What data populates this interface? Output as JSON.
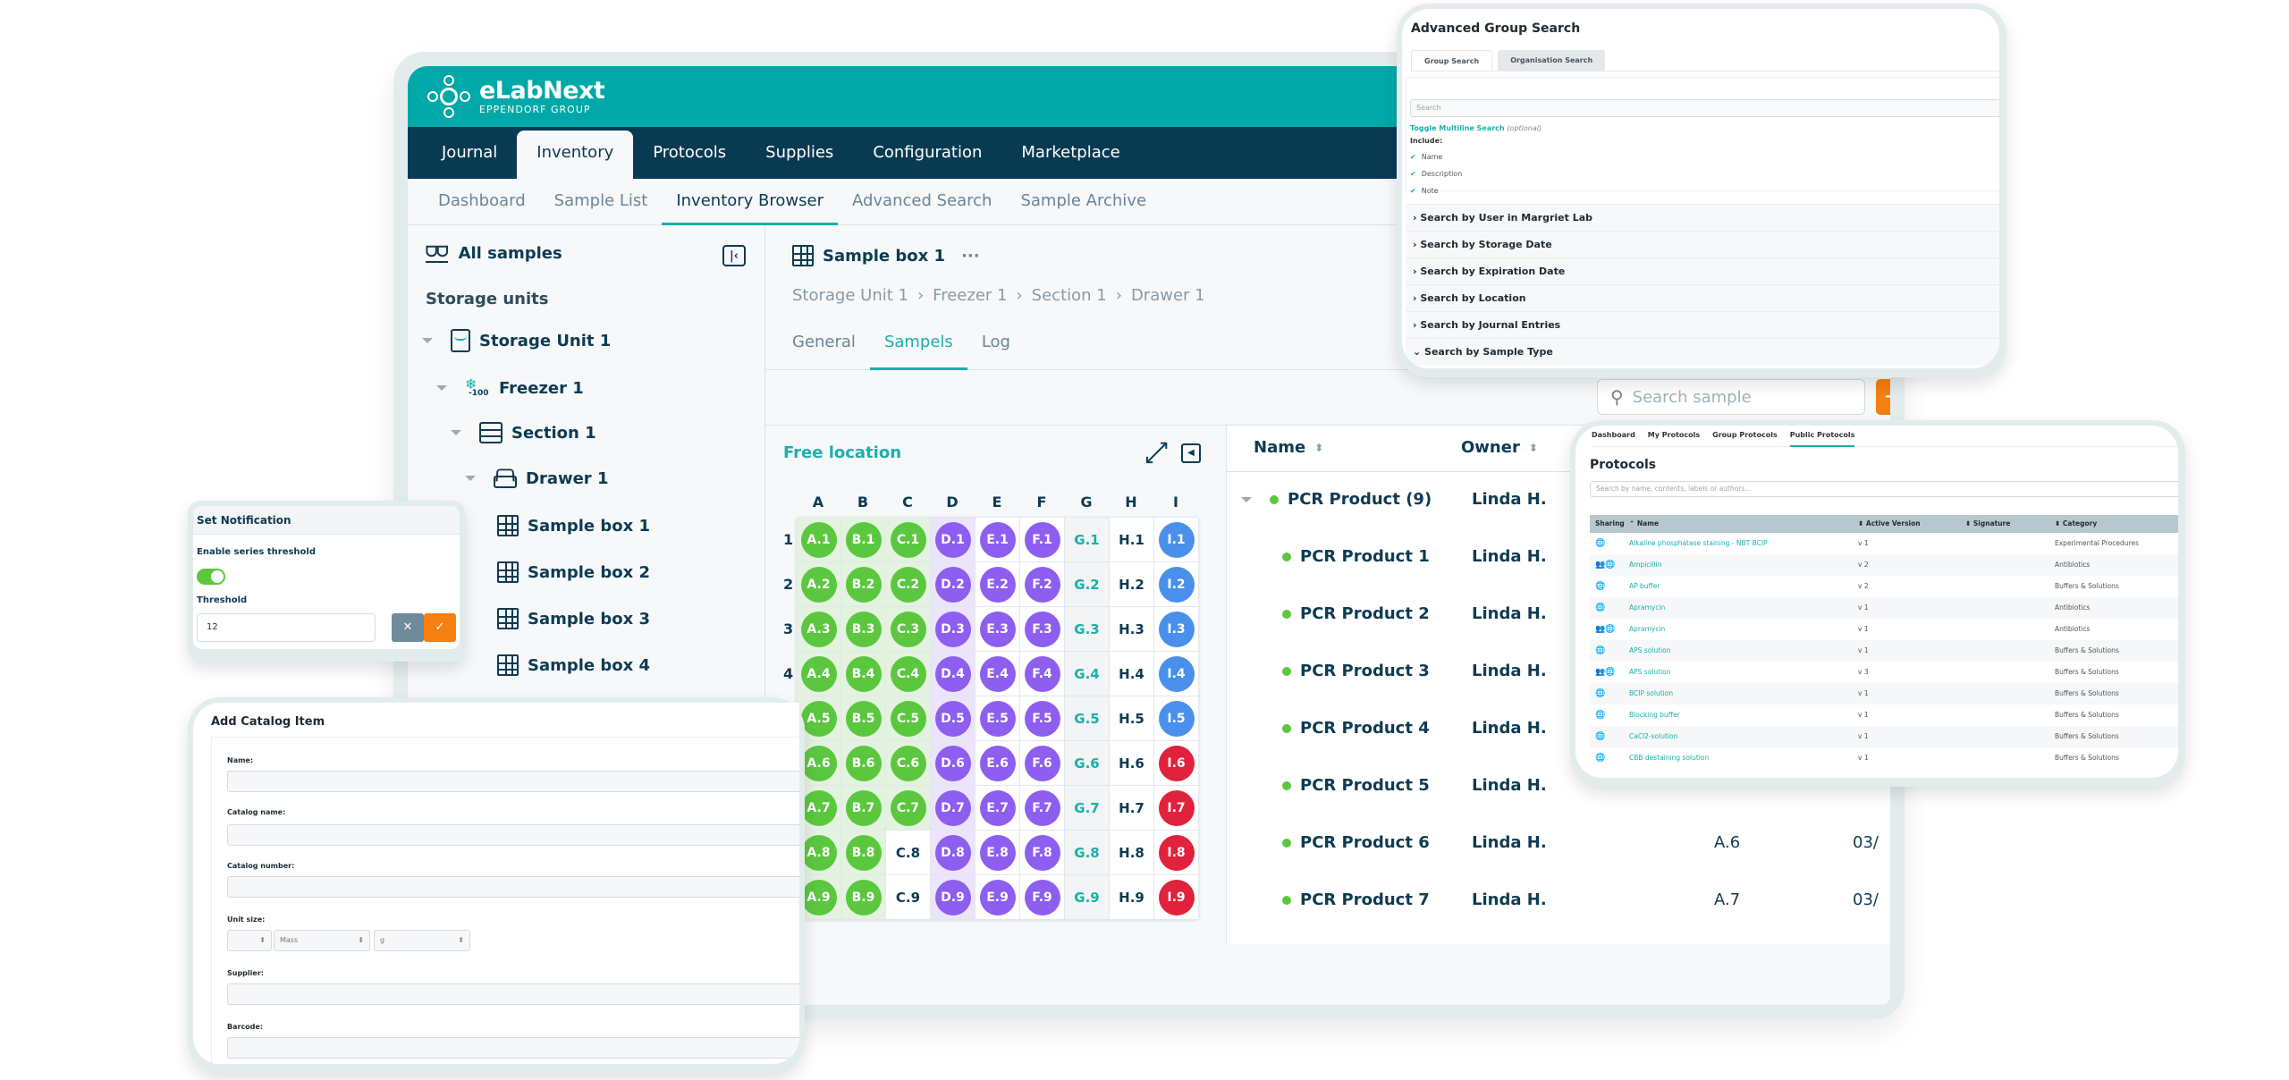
{
  "brand": {
    "name": "eLabNext",
    "sub": "EPPENDORF GROUP",
    "accent": "#00a8a8",
    "nav_bg": "#083a52",
    "action": "#f57f11"
  },
  "main_nav": [
    "Journal",
    "Inventory",
    "Protocols",
    "Supplies",
    "Configuration",
    "Marketplace"
  ],
  "main_nav_active": "Inventory",
  "sub_nav": [
    "Dashboard",
    "Sample List",
    "Inventory Browser",
    "Advanced Search",
    "Sample Archive"
  ],
  "sub_nav_active": "Inventory Browser",
  "sidebar": {
    "all_samples": "All samples",
    "storage_units_label": "Storage units",
    "tree": [
      {
        "label": "Storage Unit 1",
        "icon": "storage-unit-icon",
        "level": 0,
        "expanded": true
      },
      {
        "label": "Freezer 1",
        "icon": "freezer-icon",
        "icon_text": "-100",
        "level": 1,
        "expanded": true
      },
      {
        "label": "Section 1",
        "icon": "section-icon",
        "level": 2,
        "expanded": true
      },
      {
        "label": "Drawer 1",
        "icon": "drawer-icon",
        "level": 3,
        "expanded": true
      },
      {
        "label": "Sample box 1",
        "icon": "sample-box-icon",
        "level": 4
      },
      {
        "label": "Sample box 2",
        "icon": "sample-box-icon",
        "level": 4
      },
      {
        "label": "Sample box 3",
        "icon": "sample-box-icon",
        "level": 4
      },
      {
        "label": "Sample box 4",
        "icon": "sample-box-icon",
        "level": 4
      }
    ]
  },
  "content": {
    "title": "Sample box 1",
    "more": "···",
    "breadcrumb": [
      "Storage Unit 1",
      "Freezer 1",
      "Section 1",
      "Drawer 1"
    ],
    "breadcrumb_sep": "›",
    "tabs": [
      "General",
      "Sampels",
      "Log"
    ],
    "active_tab": "Sampels",
    "search_placeholder": "Search sample",
    "add_label": "+"
  },
  "plate": {
    "title": "Free location",
    "columns": [
      "A",
      "B",
      "C",
      "D",
      "E",
      "F",
      "G",
      "H",
      "I"
    ],
    "rows": [
      "1",
      "2",
      "3",
      "4",
      "5",
      "6",
      "7",
      "8",
      "9"
    ],
    "colors": {
      "green": "#5bc73f",
      "purple": "#8d5ef0",
      "blue": "#4a90ea",
      "red": "#e0223d"
    },
    "column_status": {
      "A": "green",
      "B": "green",
      "C": "green",
      "D": "purple",
      "E": "purple",
      "F": "purple",
      "G": "free",
      "H": "empty",
      "I": "blue"
    },
    "overrides": {
      "C.8": "empty",
      "C.9": "empty",
      "I.6": "red",
      "I.7": "red",
      "I.8": "red",
      "I.9": "red"
    }
  },
  "sample_list": {
    "columns": [
      "Name",
      "Owner"
    ],
    "group": {
      "name": "PCR Product (9)",
      "owner": "Linda H."
    },
    "rows": [
      {
        "name": "PCR Product 1",
        "owner": "Linda H.",
        "position": "",
        "date": ""
      },
      {
        "name": "PCR Product 2",
        "owner": "Linda H.",
        "position": "",
        "date": ""
      },
      {
        "name": "PCR Product 3",
        "owner": "Linda H.",
        "position": "",
        "date": ""
      },
      {
        "name": "PCR Product 4",
        "owner": "Linda H.",
        "position": "",
        "date": ""
      },
      {
        "name": "PCR Product 5",
        "owner": "Linda H.",
        "position": "",
        "date": ""
      },
      {
        "name": "PCR Product 6",
        "owner": "Linda H.",
        "position": "A.6",
        "date": "03/"
      },
      {
        "name": "PCR Product 7",
        "owner": "Linda H.",
        "position": "A.7",
        "date": "03/"
      }
    ]
  },
  "advanced_search": {
    "title": "Advanced Group Search",
    "tabs": [
      "Group Search",
      "Organisation Search"
    ],
    "search_placeholder": "Search",
    "toggle_label": "Toggle Multiline Search",
    "toggle_hint": "(optional)",
    "include_label": "Include:",
    "include": [
      "Name",
      "Description",
      "Note"
    ],
    "sections": [
      {
        "label": "Search by User in Margriet Lab",
        "open": false
      },
      {
        "label": "Search by Storage Date",
        "open": false
      },
      {
        "label": "Search by Expiration Date",
        "open": false
      },
      {
        "label": "Search by Location",
        "open": false
      },
      {
        "label": "Search by Journal Entries",
        "open": false
      },
      {
        "label": "Search by Sample Type",
        "open": true
      }
    ]
  },
  "protocols": {
    "tabs": [
      "Dashboard",
      "My Protocols",
      "Group Protocols",
      "Public Protocols"
    ],
    "active_tab": "Public Protocols",
    "title": "Protocols",
    "search_placeholder": "Search by name, contents, labels or authors...",
    "columns": [
      "Sharing",
      "Name",
      "Active Version",
      "Signature",
      "Category"
    ],
    "rows": [
      {
        "sharing": "public",
        "name": "Alkaline phosphatase staining - NBT BCIP",
        "version": "v 1",
        "signature": "",
        "category": "Experimental Procedures"
      },
      {
        "sharing": "group+public",
        "name": "Ampicillin",
        "version": "v 2",
        "signature": "",
        "category": "Antibiotics"
      },
      {
        "sharing": "public",
        "name": "AP buffer",
        "version": "v 2",
        "signature": "",
        "category": "Buffers & Solutions"
      },
      {
        "sharing": "public",
        "name": "Apramycin",
        "version": "v 1",
        "signature": "",
        "category": "Antibiotics"
      },
      {
        "sharing": "group+public",
        "name": "Apramycin",
        "version": "v 1",
        "signature": "",
        "category": "Antibiotics"
      },
      {
        "sharing": "public",
        "name": "APS solution",
        "version": "v 1",
        "signature": "",
        "category": "Buffers & Solutions"
      },
      {
        "sharing": "group+public",
        "name": "APS solution",
        "version": "v 3",
        "signature": "",
        "category": "Buffers & Solutions"
      },
      {
        "sharing": "public",
        "name": "BCIP solution",
        "version": "v 1",
        "signature": "",
        "category": "Buffers & Solutions"
      },
      {
        "sharing": "public",
        "name": "Blocking buffer",
        "version": "v 1",
        "signature": "",
        "category": "Buffers & Solutions"
      },
      {
        "sharing": "public",
        "name": "CaCl2-solution",
        "version": "v 1",
        "signature": "",
        "category": "Buffers & Solutions"
      },
      {
        "sharing": "public",
        "name": "CBB destaining solution",
        "version": "v 1",
        "signature": "",
        "category": "Buffers & Solutions"
      }
    ]
  },
  "notification": {
    "title": "Set Notification",
    "enable_label": "Enable series threshold",
    "enabled": true,
    "threshold_label": "Threshold",
    "threshold_value": "12",
    "cancel": "✕",
    "confirm": "✓"
  },
  "catalog": {
    "title": "Add Catalog Item",
    "fields": [
      "Name:",
      "Catalog name:",
      "Catalog number:",
      "Unit size:",
      "Supplier:",
      "Barcode:"
    ],
    "unit_type": "Mass",
    "unit": "g"
  }
}
